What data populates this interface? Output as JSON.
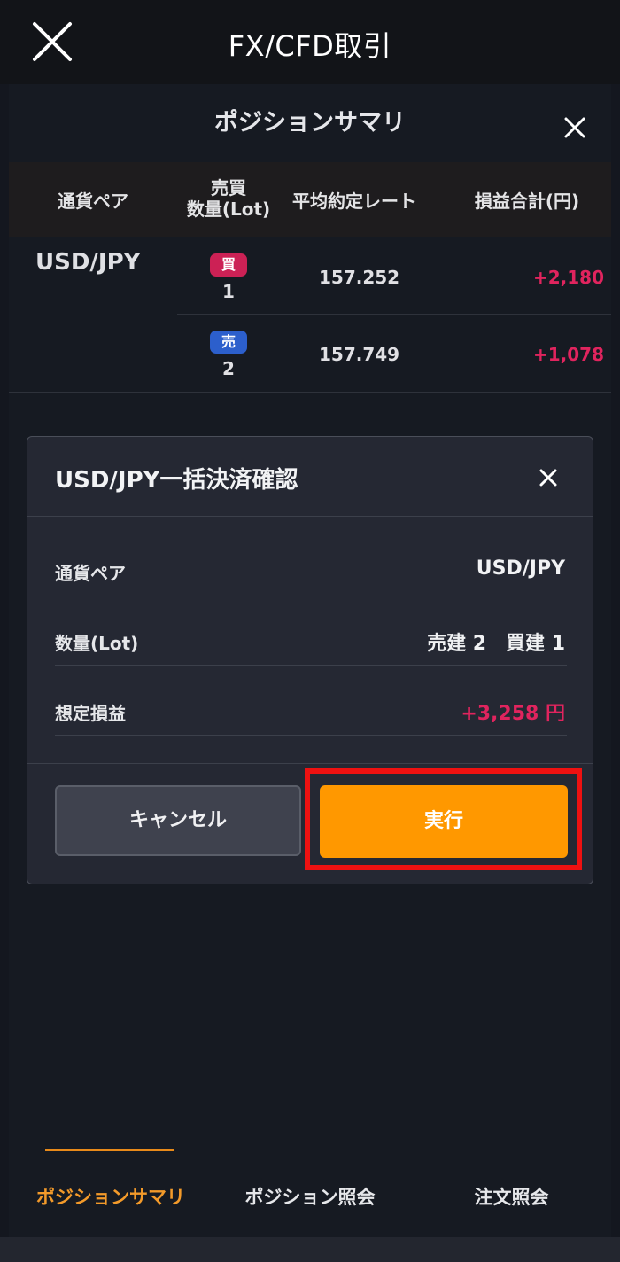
{
  "app": {
    "title": "FX/CFD取引"
  },
  "sheet": {
    "title": "ポジションサマリ",
    "columns": {
      "pair": "通貨ペア",
      "qty_line1": "売買",
      "qty_line2": "数量(Lot)",
      "rate": "平均約定レート",
      "pnl": "損益合計(円)"
    },
    "pair": "USD/JPY",
    "rows": [
      {
        "side": "買",
        "lot": "1",
        "rate": "157.252",
        "pnl": "+2,180"
      },
      {
        "side": "売",
        "lot": "2",
        "rate": "157.749",
        "pnl": "+1,078"
      }
    ]
  },
  "dialog": {
    "title": "USD/JPY一括決済確認",
    "fields": [
      {
        "label": "通貨ペア",
        "value": "USD/JPY"
      },
      {
        "label": "数量(Lot)",
        "value": "売建 2　買建 1"
      },
      {
        "label": "想定損益",
        "value": "+3,258 円"
      }
    ],
    "cancel_label": "キャンセル",
    "execute_label": "実行"
  },
  "tabs": [
    {
      "label": "ポジションサマリ",
      "active": true
    },
    {
      "label": "ポジション照会",
      "active": false
    },
    {
      "label": "注文照会",
      "active": false
    }
  ],
  "colors": {
    "accent": "#ff9800",
    "profit": "#e0245e",
    "buy_badge": "#cc2155",
    "sell_badge": "#2c5fcc",
    "highlight_box": "#ee1111"
  }
}
